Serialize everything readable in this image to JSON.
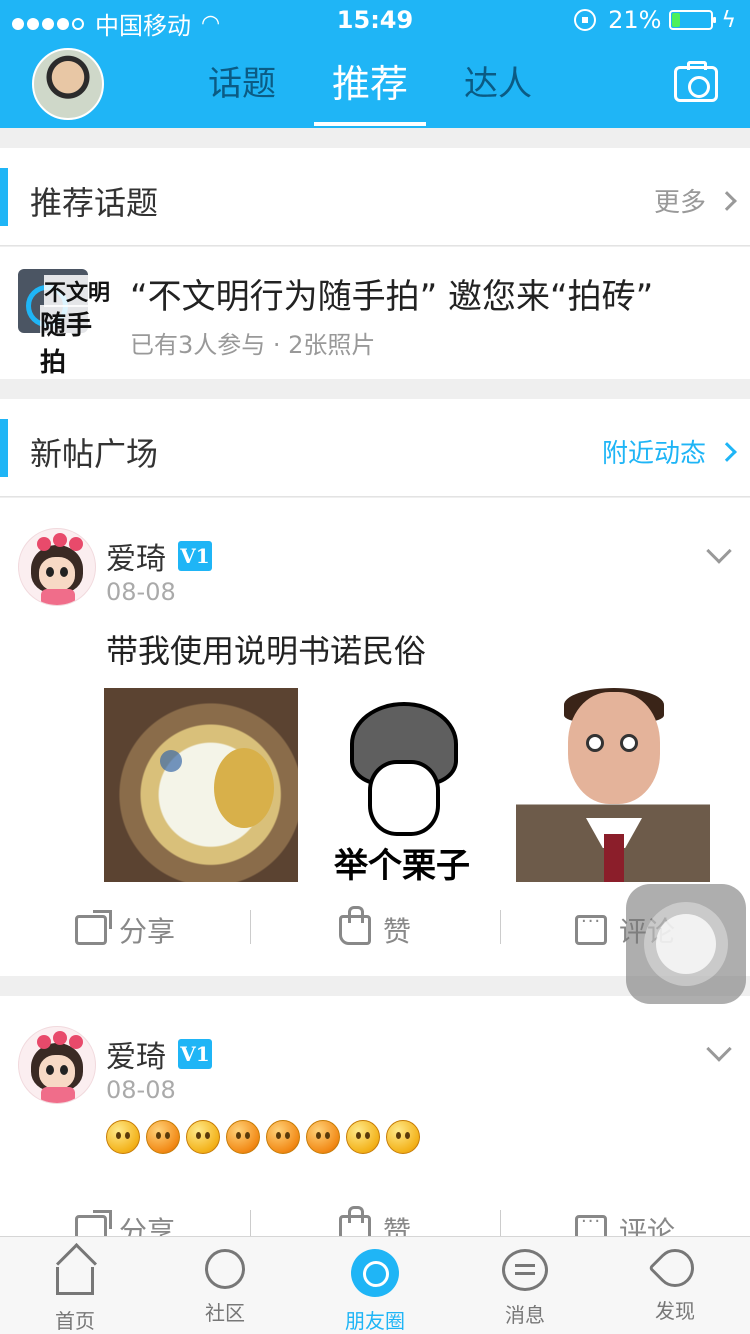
{
  "status_bar": {
    "carrier": "中国移动",
    "time": "15:49",
    "battery_text": "21%",
    "battery_level": 0.21
  },
  "header": {
    "tabs": [
      {
        "label": "话题",
        "active": false
      },
      {
        "label": "推荐",
        "active": true
      },
      {
        "label": "达人",
        "active": false
      }
    ],
    "icons": {
      "camera": "camera-icon",
      "avatar": "avatar"
    }
  },
  "recommended_topics": {
    "title": "推荐话题",
    "more_label": "更多",
    "topic": {
      "logo_line1": "不文明",
      "logo_line2": "随手拍",
      "title": "“不文明行为随手拍” 邀您来“拍砖”",
      "subtitle": "已有3人参与 · 2张照片"
    }
  },
  "new_posts": {
    "title": "新帖广场",
    "nearby_label": "附近动态"
  },
  "posts": [
    {
      "author": "爱琦",
      "badge": "V1",
      "date": "08-08",
      "text": "带我使用说明书诺民俗",
      "image_caption": "举个栗子"
    },
    {
      "author": "爱琦",
      "badge": "V1",
      "date": "08-08",
      "emoji_count": 8
    }
  ],
  "post_actions": {
    "share": "分享",
    "like": "赞",
    "comment": "评论"
  },
  "bottom_nav": [
    {
      "label": "首页",
      "icon": "home-icon",
      "active": false
    },
    {
      "label": "社区",
      "icon": "community-icon",
      "active": false
    },
    {
      "label": "朋友圈",
      "icon": "moments-icon",
      "active": true
    },
    {
      "label": "消息",
      "icon": "message-icon",
      "active": false
    },
    {
      "label": "发现",
      "icon": "discover-icon",
      "active": false
    }
  ],
  "colors": {
    "accent": "#1fb5f6",
    "header_bg": "#1fb5f6",
    "inactive_tab": "#0b5b84"
  }
}
